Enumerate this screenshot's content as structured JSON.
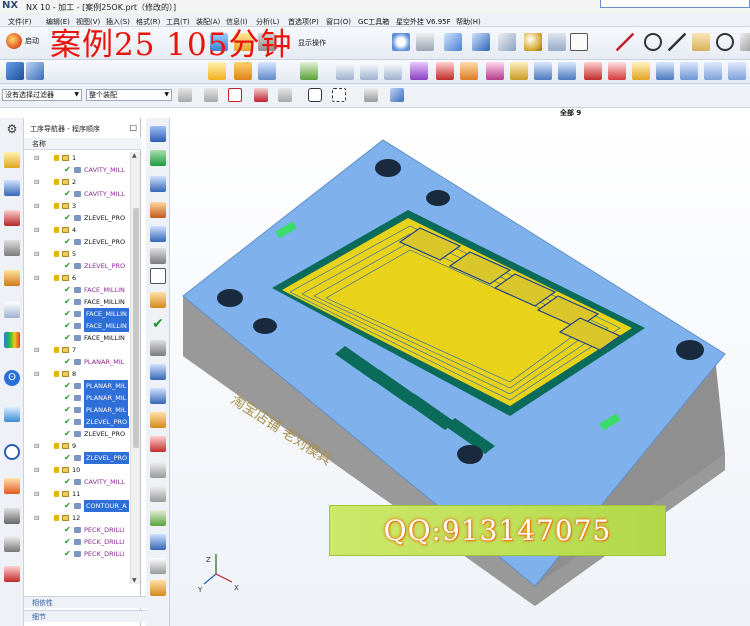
{
  "app": {
    "logo": "NX",
    "window_title": "NX 10 - 加工 - [案例25OK.prt（修改的）]"
  },
  "menu": [
    "文件(F)",
    "编辑(E)",
    "视图(V)",
    "插入(S)",
    "格式(R)",
    "工具(T)",
    "装配(A)",
    "信息(I)",
    "分析(L)",
    "首选项(P)",
    "窗口(O)",
    "GC工具箱",
    "星空外挂 V6.95F",
    "帮助(H)"
  ],
  "toolbar": {
    "start_label": "启动",
    "overlay_title": "案例25  105分钟",
    "mid_label": "显示操作"
  },
  "filters": {
    "type_filter": "没有选择过滤器",
    "assembly_filter": "整个装配"
  },
  "navigator": {
    "title": "工序导航器 - 程序顺序",
    "column": "名称",
    "rows": [
      {
        "level": 1,
        "type": "group",
        "label": "1"
      },
      {
        "level": 2,
        "type": "op",
        "label": "CAVITY_MILL",
        "style": "purple"
      },
      {
        "level": 1,
        "type": "group",
        "label": "2"
      },
      {
        "level": 2,
        "type": "op",
        "label": "CAVITY_MILL",
        "style": "purple"
      },
      {
        "level": 1,
        "type": "group",
        "label": "3"
      },
      {
        "level": 2,
        "type": "op",
        "label": "ZLEVEL_PRO",
        "style": "num"
      },
      {
        "level": 1,
        "type": "group",
        "label": "4"
      },
      {
        "level": 2,
        "type": "op",
        "label": "ZLEVEL_PRO",
        "style": "num"
      },
      {
        "level": 1,
        "type": "group",
        "label": "5"
      },
      {
        "level": 2,
        "type": "op",
        "label": "ZLEVEL_PRO",
        "style": "purple"
      },
      {
        "level": 1,
        "type": "group",
        "label": "6"
      },
      {
        "level": 2,
        "type": "op",
        "label": "FACE_MILLIN",
        "style": "purple"
      },
      {
        "level": 2,
        "type": "op",
        "label": "FACE_MILLIN",
        "style": "num"
      },
      {
        "level": 2,
        "type": "op",
        "label": "FACE_MILLIN",
        "style": "sel"
      },
      {
        "level": 2,
        "type": "op",
        "label": "FACE_MILLIN",
        "style": "sel"
      },
      {
        "level": 2,
        "type": "op",
        "label": "FACE_MILLIN",
        "style": "num"
      },
      {
        "level": 1,
        "type": "group",
        "label": "7"
      },
      {
        "level": 2,
        "type": "op",
        "label": "PLANAR_MIL",
        "style": "purple"
      },
      {
        "level": 1,
        "type": "group",
        "label": "8"
      },
      {
        "level": 2,
        "type": "op",
        "label": "PLANAR_MIL",
        "style": "sel"
      },
      {
        "level": 2,
        "type": "op",
        "label": "PLANAR_MIL",
        "style": "sel"
      },
      {
        "level": 2,
        "type": "op",
        "label": "PLANAR_MIL",
        "style": "sel"
      },
      {
        "level": 2,
        "type": "op",
        "label": "ZLEVEL_PRO",
        "style": "sel"
      },
      {
        "level": 2,
        "type": "op",
        "label": "ZLEVEL_PRO",
        "style": "num"
      },
      {
        "level": 1,
        "type": "group",
        "label": "9"
      },
      {
        "level": 2,
        "type": "op",
        "label": "ZLEVEL_PRO",
        "style": "sel"
      },
      {
        "level": 1,
        "type": "group",
        "label": "10"
      },
      {
        "level": 2,
        "type": "op",
        "label": "CAVITY_MILL",
        "style": "purple"
      },
      {
        "level": 1,
        "type": "group",
        "label": "11"
      },
      {
        "level": 2,
        "type": "op",
        "label": "CONTOUR_A",
        "style": "sel"
      },
      {
        "level": 1,
        "type": "group",
        "label": "12"
      },
      {
        "level": 2,
        "type": "op",
        "label": "PECK_DRILLI",
        "style": "purple"
      },
      {
        "level": 2,
        "type": "op",
        "label": "PECK_DRILLI",
        "style": "purple"
      },
      {
        "level": 2,
        "type": "op",
        "label": "PECK_DRILLI",
        "style": "purple"
      }
    ],
    "footer_dependency": "相依性",
    "footer_details": "细节"
  },
  "viewport": {
    "top_label": "全部 9",
    "engraving": "淘宝店铺  老刘模具",
    "qq_banner": "QQ:913147075"
  },
  "colors": {
    "part_top": "#7fb2ec",
    "part_side": "#8f8f8f",
    "toolpath_yellow": "#e8d21a",
    "accent_red": "#e8140c"
  }
}
